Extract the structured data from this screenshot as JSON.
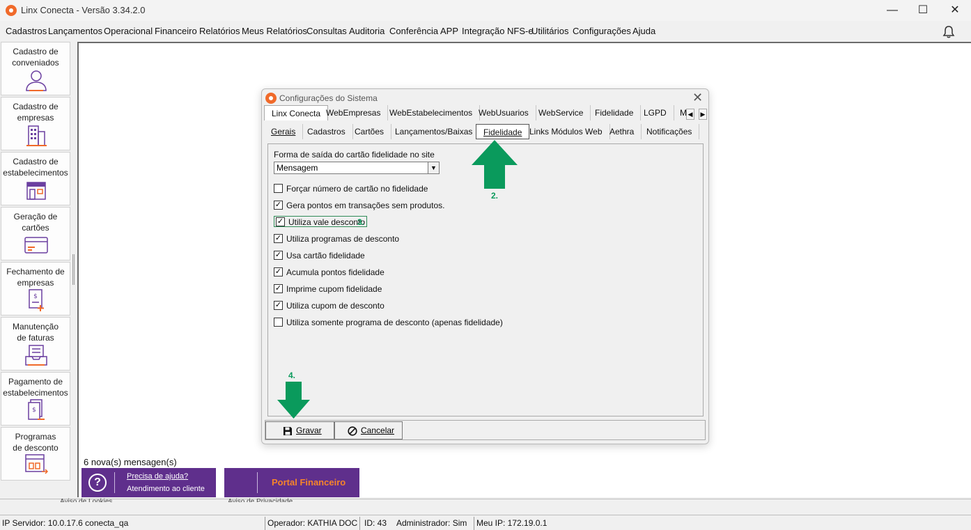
{
  "window": {
    "title": "Linx Conecta - Versão 3.34.2.0",
    "min_glyph": "—",
    "max_glyph": "☐",
    "close_glyph": "✕"
  },
  "menu": [
    "Cadastros",
    "Lançamentos",
    "Operacional",
    "Financeiro",
    "Relatórios",
    "Meus Relatórios",
    "Consultas",
    "Auditoria",
    "Conferência",
    "APP",
    "Integração NFS-e",
    "Utilitários",
    "Configurações",
    "Ajuda"
  ],
  "sidebar": [
    {
      "label_1": "Cadastro de",
      "label_2": "conveniados",
      "icon": "user-icon"
    },
    {
      "label_1": "Cadastro de",
      "label_2": "empresas",
      "icon": "building-icon"
    },
    {
      "label_1": "Cadastro de",
      "label_2": "estabelecimentos",
      "icon": "store-icon"
    },
    {
      "label_1": "Geração de",
      "label_2": "cartões",
      "icon": "card-icon"
    },
    {
      "label_1": "Fechamento de",
      "label_2": "empresas",
      "icon": "invoice-close-icon"
    },
    {
      "label_1": "Manutenção",
      "label_2": "de faturas",
      "icon": "tray-icon"
    },
    {
      "label_1": "Pagamento de",
      "label_2": "estabelecimentos",
      "icon": "payment-icon"
    },
    {
      "label_1": "Programas",
      "label_2": "de desconto",
      "icon": "discount-icon"
    }
  ],
  "dialog": {
    "title": "Configurações do Sistema",
    "close_glyph": "✕",
    "top_tabs": [
      "Linx Conecta",
      "WebEmpresas",
      "WebEstabelecimentos",
      "WebUsuarios",
      "WebService",
      "Fidelidade",
      "LGPD",
      "M"
    ],
    "active_top_tab": "Linx Conecta",
    "sub_tabs": [
      "Gerais",
      "Cadastros",
      "Cartões",
      "Lançamentos/Baixas",
      "Fidelidade",
      "Links Módulos Web",
      "Aethra",
      "Notificações"
    ],
    "active_sub_tab": "Fidelidade",
    "field_label": "Forma de saída do cartão fidelidade no site",
    "select_value": "Mensagem",
    "checkboxes": [
      {
        "label": "Forçar número de cartão no fidelidade",
        "checked": false
      },
      {
        "label": "Gera pontos em transações sem produtos.",
        "checked": true
      },
      {
        "label": "Utiliza vale desconto",
        "checked": true
      },
      {
        "label": "Utiliza programas de desconto",
        "checked": true
      },
      {
        "label": "Usa cartão fidelidade",
        "checked": true
      },
      {
        "label": "Acumula pontos fidelidade",
        "checked": true
      },
      {
        "label": "Imprime cupom fidelidade",
        "checked": true
      },
      {
        "label": "Utiliza cupom de desconto",
        "checked": true
      },
      {
        "label": "Utiliza somente programa de desconto (apenas fidelidade)",
        "checked": false
      }
    ],
    "save_label": "Gravar",
    "cancel_label": "Cancelar"
  },
  "annotations": {
    "step2": "2.",
    "step3": "3.",
    "step4": "4.",
    "arrow_color": "#0a9a5c"
  },
  "messages": "6 nova(s) mensagen(s)",
  "help_banner": {
    "line1": "Precisa de ajuda?",
    "line2": "Atendimento ao cliente",
    "icon_glyph": "?"
  },
  "portal_banner": {
    "label": "Portal Financeiro"
  },
  "cut_labels": {
    "left": "Aviso de Lookies",
    "right": "Aviso de Privacidade"
  },
  "status": {
    "server": "IP Servidor: 10.0.17.6 conecta_qa",
    "operator": "Operador: KATHIA DOC",
    "id": "ID: 43",
    "admin": "Administrador: Sim",
    "ip": "Meu IP: 172.19.0.1"
  },
  "colors": {
    "brand_orange": "#f06a2a",
    "banner_purple": "#5f2f8c",
    "icon_purple": "#6b3fa0",
    "annotation_green": "#0a9a5c",
    "portal_orange": "#f6842a"
  }
}
